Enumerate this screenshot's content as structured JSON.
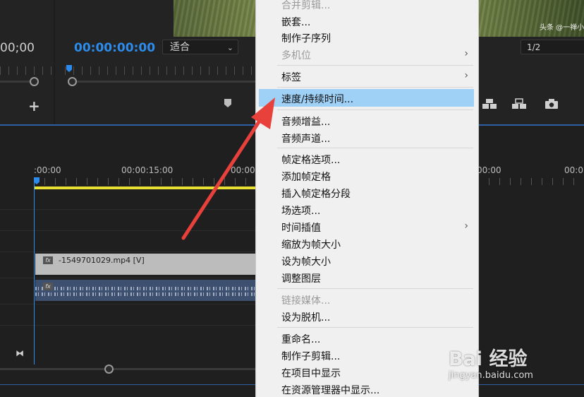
{
  "source_monitor": {
    "timecode": "00;00"
  },
  "program_monitor": {
    "timecode": "00:00:00:00",
    "fit_label": "适合",
    "resolution_label": "1/2",
    "watermark": "头条 @一禅小"
  },
  "timeline": {
    "ruler_labels": [
      ":00:00",
      "00:00:15:00",
      "00:00",
      "00:00",
      "00:0"
    ],
    "video_clip_label": "-1549701029.mp4 [V]",
    "fx_label": "fx"
  },
  "context_menu": {
    "items": [
      {
        "label": "合并剪辑...",
        "disabled": true
      },
      {
        "label": "嵌套...",
        "disabled": false
      },
      {
        "label": "制作子序列",
        "disabled": false
      },
      {
        "label": "多机位",
        "disabled": true,
        "submenu": true
      },
      {
        "label": "标签",
        "disabled": false,
        "submenu": true
      },
      {
        "label": "速度/持续时间...",
        "disabled": false,
        "highlighted": true
      },
      {
        "label": "音频增益...",
        "disabled": false
      },
      {
        "label": "音频声道...",
        "disabled": false
      },
      {
        "label": "帧定格选项...",
        "disabled": false
      },
      {
        "label": "添加帧定格",
        "disabled": false
      },
      {
        "label": "插入帧定格分段",
        "disabled": false
      },
      {
        "label": "场选项...",
        "disabled": false
      },
      {
        "label": "时间插值",
        "disabled": false,
        "submenu": true
      },
      {
        "label": "缩放为帧大小",
        "disabled": false
      },
      {
        "label": "设为帧大小",
        "disabled": false
      },
      {
        "label": "调整图层",
        "disabled": false
      },
      {
        "label": "链接媒体...",
        "disabled": true
      },
      {
        "label": "设为脱机...",
        "disabled": false
      },
      {
        "label": "重命名...",
        "disabled": false
      },
      {
        "label": "制作子剪辑...",
        "disabled": false
      },
      {
        "label": "在项目中显示",
        "disabled": false
      },
      {
        "label": "在资源管理器中显示...",
        "disabled": false
      }
    ],
    "submenu_glyph": "›",
    "highlight_color": "#9fd0f6"
  },
  "watermark": {
    "brand": "Bai 经验",
    "url": "jingyan.baidu.com"
  },
  "colors": {
    "accent_blue": "#2d8ceb",
    "work_area": "#e8e033",
    "arrow_red": "#e8403a"
  }
}
